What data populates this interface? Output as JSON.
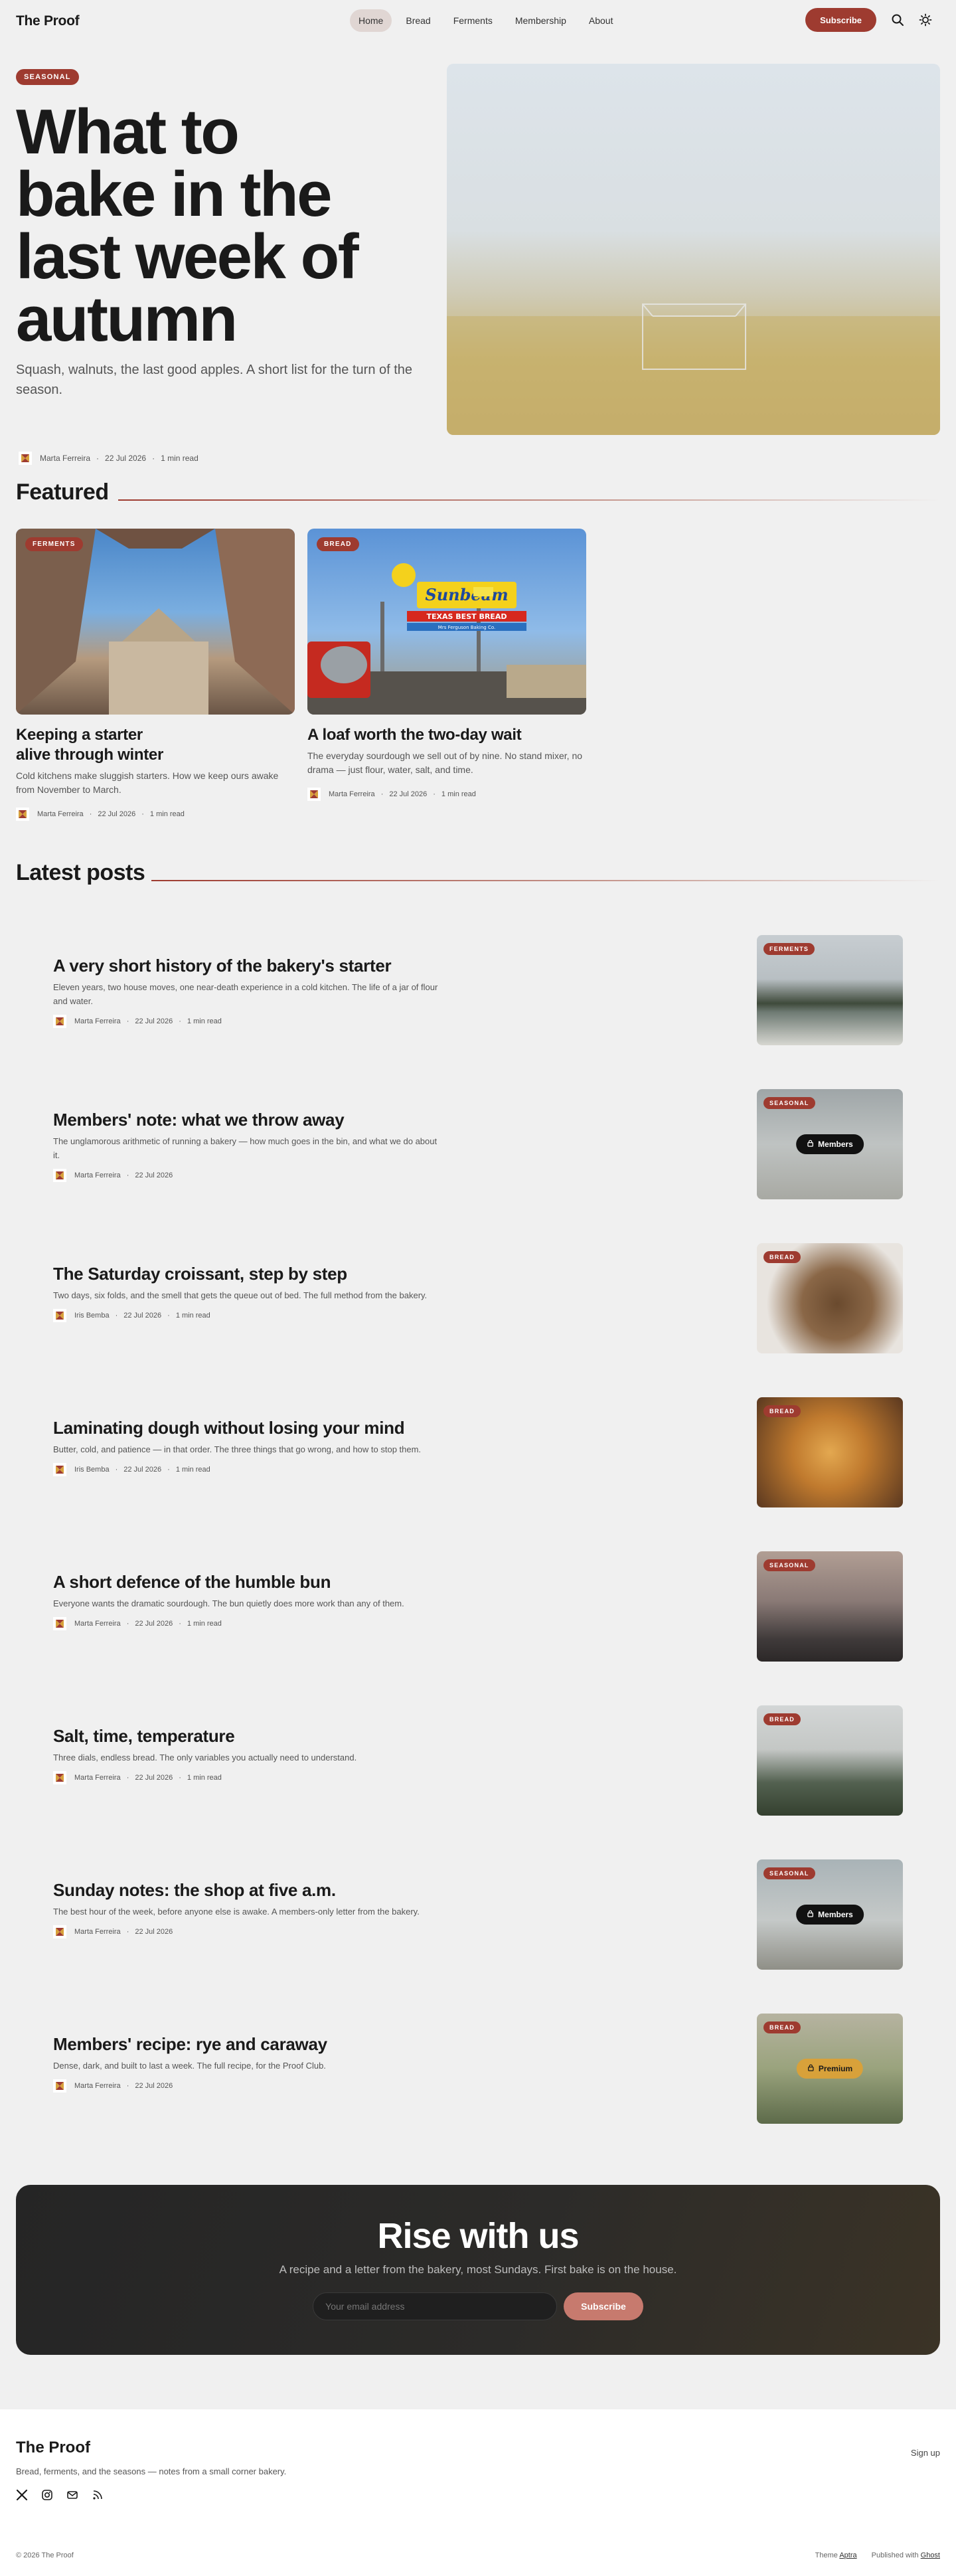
{
  "site": {
    "name": "The Proof",
    "nav": [
      "Home",
      "Bread",
      "Ferments",
      "Membership",
      "About"
    ],
    "active_nav": "Home",
    "subscribe_label": "Subscribe",
    "icons": [
      "search-icon",
      "theme-toggle-icon"
    ]
  },
  "hero": {
    "tag": "SEASONAL",
    "title": "What to bake in the last week of autumn",
    "subtitle": "Squash, walnuts, the last good apples. A short list for the turn of the season.",
    "author": "Marta Ferreira",
    "date": "22 Jul 2026",
    "read_time": "1 min read"
  },
  "featured": {
    "heading": "Featured",
    "items": [
      {
        "tag": "FERMENTS",
        "title": "Keeping a starter alive through winter",
        "excerpt": "Cold kitchens make sluggish starters. How we keep ours awake from November to March.",
        "author": "Marta Ferreira",
        "date": "22 Jul 2026",
        "read_time": "1 min read"
      },
      {
        "tag": "BREAD",
        "title": "A loaf worth the two-day wait",
        "excerpt": "The everyday sourdough we sell out of by nine. No stand mixer, no drama — just flour, water, salt, and time.",
        "author": "Marta Ferreira",
        "date": "22 Jul 2026",
        "read_time": "1 min read",
        "sign_text": [
          "Sunbeam",
          "TEXAS BEST BREAD",
          "Mrs Ferguson Baking Co."
        ]
      }
    ]
  },
  "latest": {
    "heading": "Latest posts",
    "posts": [
      {
        "tag": "FERMENTS",
        "title": "A very short history of the bakery's starter",
        "excerpt": "Eleven years, two house moves, one near-death experience in a cold kitchen. The life of a jar of flour and water.",
        "author": "Marta Ferreira",
        "date": "22 Jul 2026",
        "read_time": "1 min read",
        "access": ""
      },
      {
        "tag": "SEASONAL",
        "title": "Members' note: what we throw away",
        "excerpt": "The unglamorous arithmetic of running a bakery — how much goes in the bin, and what we do about it.",
        "author": "Marta Ferreira",
        "date": "22 Jul 2026",
        "read_time": "",
        "access": "Members"
      },
      {
        "tag": "BREAD",
        "title": "The Saturday croissant, step by step",
        "excerpt": "Two days, six folds, and the smell that gets the queue out of bed. The full method from the bakery.",
        "author": "Iris Bemba",
        "date": "22 Jul 2026",
        "read_time": "1 min read",
        "access": ""
      },
      {
        "tag": "BREAD",
        "title": "Laminating dough without losing your mind",
        "excerpt": "Butter, cold, and patience — in that order. The three things that go wrong, and how to stop them.",
        "author": "Iris Bemba",
        "date": "22 Jul 2026",
        "read_time": "1 min read",
        "access": ""
      },
      {
        "tag": "SEASONAL",
        "title": "A short defence of the humble bun",
        "excerpt": "Everyone wants the dramatic sourdough. The bun quietly does more work than any of them.",
        "author": "Marta Ferreira",
        "date": "22 Jul 2026",
        "read_time": "1 min read",
        "access": ""
      },
      {
        "tag": "BREAD",
        "title": "Salt, time, temperature",
        "excerpt": "Three dials, endless bread. The only variables you actually need to understand.",
        "author": "Marta Ferreira",
        "date": "22 Jul 2026",
        "read_time": "1 min read",
        "access": ""
      },
      {
        "tag": "SEASONAL",
        "title": "Sunday notes: the shop at five a.m.",
        "excerpt": "The best hour of the week, before anyone else is awake. A members-only letter from the bakery.",
        "author": "Marta Ferreira",
        "date": "22 Jul 2026",
        "read_time": "",
        "access": "Members"
      },
      {
        "tag": "BREAD",
        "title": "Members' recipe: rye and caraway",
        "excerpt": "Dense, dark, and built to last a week. The full recipe, for the Proof Club.",
        "author": "Marta Ferreira",
        "date": "22 Jul 2026",
        "read_time": "",
        "access": "Premium"
      }
    ]
  },
  "cta": {
    "title": "Rise with us",
    "subtitle": "A recipe and a letter from the bakery, most Sundays. First bake is on the house.",
    "email_placeholder": "Your email address",
    "button": "Subscribe"
  },
  "footer": {
    "name": "The Proof",
    "tagline": "Bread, ferments, and the seasons — notes from a small corner bakery.",
    "signup": "Sign up",
    "social_icons": [
      "x-icon",
      "instagram-icon",
      "email-icon",
      "rss-icon"
    ],
    "copyright": "© 2026 The Proof",
    "theme_label": "Theme",
    "theme_name": "Aptra",
    "published_label": "Published with",
    "published_name": "Ghost"
  },
  "colors": {
    "accent": "#9e3b30",
    "background": "#f0f0f0",
    "cta_button": "#c77a6e",
    "premium": "#d8a13a"
  }
}
